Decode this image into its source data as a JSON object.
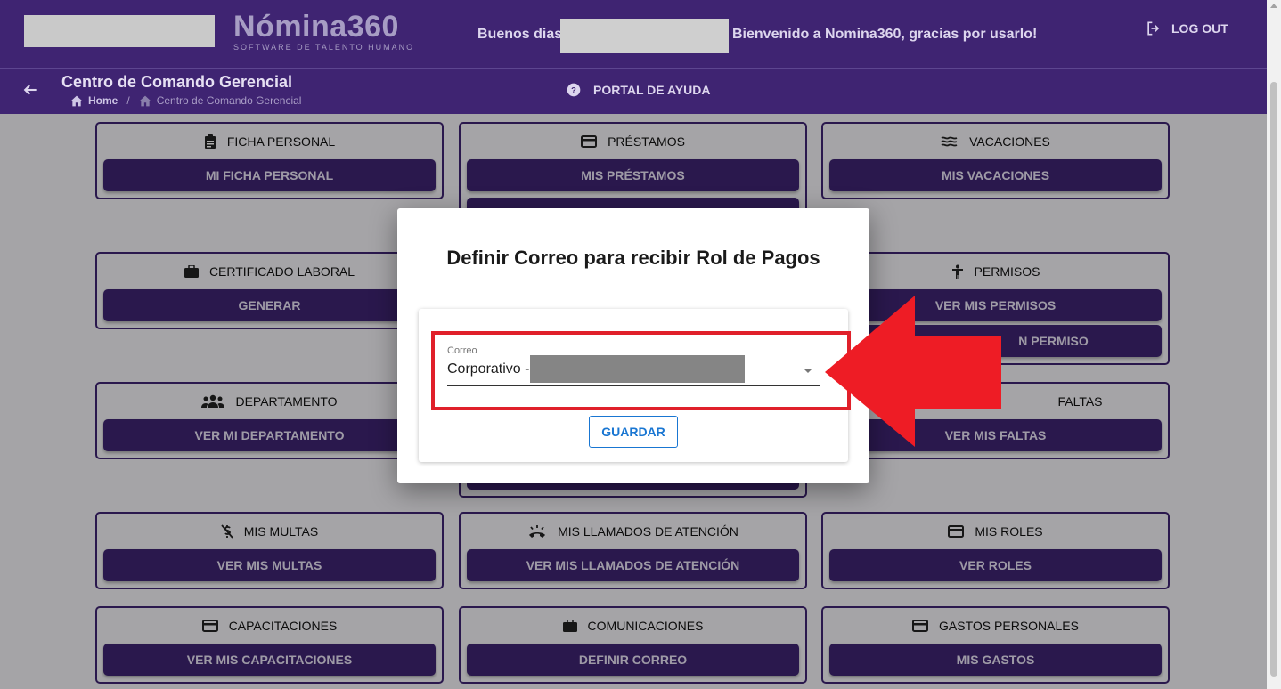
{
  "header": {
    "logo_main": "Nómina360",
    "logo_sub": "SOFTWARE DE TALENTO HUMANO",
    "greeting": "Buenos dias",
    "welcome": "Bienvenido a Nomina360, gracias por usarlo!",
    "logout_label": "LOG OUT"
  },
  "subheader": {
    "title": "Centro de Comando Gerencial",
    "breadcrumb": [
      "Home",
      "/",
      "Centro de Comando Gerencial"
    ],
    "help_label": "PORTAL DE AYUDA"
  },
  "cards": [
    {
      "title": "FICHA PERSONAL",
      "icon": "clipboard-icon",
      "buttons": [
        "MI FICHA PERSONAL"
      ]
    },
    {
      "title": "PRÉSTAMOS",
      "icon": "credit-card-icon",
      "buttons": [
        "MIS PRÉSTAMOS"
      ]
    },
    {
      "title": "VACACIONES",
      "icon": "waves-icon",
      "buttons": [
        "MIS VACACIONES"
      ]
    },
    {
      "title": "CERTIFICADO LABORAL",
      "icon": "briefcase-icon",
      "buttons": [
        "GENERAR"
      ]
    },
    {
      "title": "PERMISOS",
      "icon": "person-icon",
      "buttons": [
        "VER MIS PERMISOS",
        "N PERMISO"
      ]
    },
    {
      "title": "DEPARTAMENTO",
      "icon": "group-icon",
      "buttons": [
        "VER MI DEPARTAMENTO"
      ]
    },
    {
      "title": "FALTAS",
      "icon": "",
      "buttons": [
        "VER MIS FALTAS"
      ]
    },
    {
      "title": "MIS MULTAS",
      "icon": "no-money-icon",
      "buttons": [
        "VER MIS MULTAS"
      ]
    },
    {
      "title": "MIS LLAMADOS DE ATENCIÓN",
      "icon": "phone-ring-icon",
      "buttons": [
        "VER MIS LLAMADOS DE ATENCIÓN"
      ]
    },
    {
      "title": "MIS ROLES",
      "icon": "credit-card-icon",
      "buttons": [
        "VER ROLES"
      ]
    },
    {
      "title": "CAPACITACIONES",
      "icon": "credit-card-icon",
      "buttons": [
        "VER MIS CAPACITACIONES"
      ]
    },
    {
      "title": "COMUNICACIONES",
      "icon": "briefcase-icon",
      "buttons": [
        "DEFINIR CORREO"
      ]
    },
    {
      "title": "GASTOS PERSONALES",
      "icon": "credit-card-icon",
      "buttons": [
        "MIS GASTOS"
      ]
    }
  ],
  "modal": {
    "title": "Definir Correo para recibir Rol de Pagos",
    "field_label": "Correo",
    "field_value": "Corporativo -",
    "save_label": "GUARDAR"
  },
  "colors": {
    "brand": "#3f2472",
    "highlight": "#e0202a",
    "save_button": "#1976d2"
  }
}
